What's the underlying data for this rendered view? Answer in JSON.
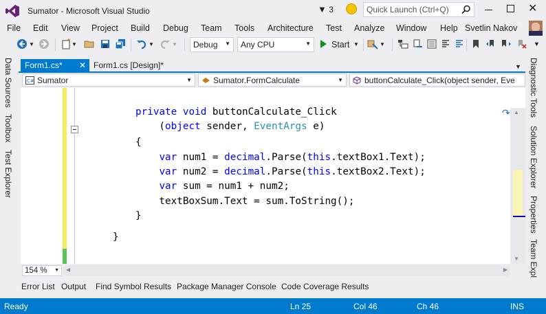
{
  "window": {
    "title": "Sumator - Microsoft Visual Studio",
    "notifications_count": "3",
    "quick_launch_placeholder": "Quick Launch (Ctrl+Q)"
  },
  "menu": {
    "items": [
      "File",
      "Edit",
      "View",
      "Project",
      "Build",
      "Debug",
      "Team",
      "Tools",
      "Architecture",
      "Test",
      "Analyze",
      "Window",
      "Help"
    ],
    "user": "Svetlin Nakov"
  },
  "toolbar": {
    "configuration": "Debug",
    "platform": "Any CPU",
    "start_label": "Start"
  },
  "left_panel": {
    "tabs": [
      "Data Sources",
      "Toolbox",
      "Test Explorer"
    ]
  },
  "right_panel": {
    "tabs": [
      "Diagnostic Tools",
      "Solution Explorer",
      "Properties",
      "Team Expl"
    ]
  },
  "doc_tabs": [
    {
      "label": "Form1.cs*",
      "active": true
    },
    {
      "label": "Form1.cs [Design]*",
      "active": false
    }
  ],
  "navigation": {
    "project": "Sumator",
    "type": "Sumator.FormCalculate",
    "member": "buttonCalculate_Click(object sender, Even"
  },
  "code": {
    "lines": [
      [
        {
          "t": "private",
          "c": "kw"
        },
        {
          "t": " ",
          "c": "tx"
        },
        {
          "t": "void",
          "c": "kw"
        },
        {
          "t": " buttonCalculate_Click",
          "c": "tx"
        }
      ],
      [
        {
          "t": "    (",
          "c": "tx"
        },
        {
          "t": "object",
          "c": "kw"
        },
        {
          "t": " sender, ",
          "c": "tx"
        },
        {
          "t": "EventArgs",
          "c": "ty"
        },
        {
          "t": " e)",
          "c": "tx"
        }
      ],
      [
        {
          "t": "{",
          "c": "tx"
        }
      ],
      [
        {
          "t": "    ",
          "c": "tx"
        },
        {
          "t": "var",
          "c": "kw"
        },
        {
          "t": " num1 = ",
          "c": "tx"
        },
        {
          "t": "decimal",
          "c": "kw"
        },
        {
          "t": ".Parse(",
          "c": "tx"
        },
        {
          "t": "this",
          "c": "kw"
        },
        {
          "t": ".textBox1.Text);",
          "c": "tx"
        }
      ],
      [
        {
          "t": "    ",
          "c": "tx"
        },
        {
          "t": "var",
          "c": "kw"
        },
        {
          "t": " num2 = ",
          "c": "tx"
        },
        {
          "t": "decimal",
          "c": "kw"
        },
        {
          "t": ".Parse(",
          "c": "tx"
        },
        {
          "t": "this",
          "c": "kw"
        },
        {
          "t": ".textBox2.Text);",
          "c": "tx"
        }
      ],
      [
        {
          "t": "    ",
          "c": "tx"
        },
        {
          "t": "var",
          "c": "kw"
        },
        {
          "t": " sum = num1 + num2;",
          "c": "tx"
        }
      ],
      [
        {
          "t": "    textBoxSum.Text = sum.ToString();",
          "c": "tx"
        }
      ],
      [
        {
          "t": "}",
          "c": "tx"
        }
      ],
      [
        {
          "t": "}",
          "c": "tx"
        }
      ]
    ]
  },
  "editor": {
    "zoom": "154 %"
  },
  "bottom_tabs": [
    "Error List",
    "Output",
    "Find Symbol Results",
    "Package Manager Console",
    "Code Coverage Results"
  ],
  "status": {
    "state": "Ready",
    "line": "Ln 25",
    "col": "Col 46",
    "ch": "Ch 46",
    "mode": "INS"
  },
  "colors": {
    "accent": "#007ACC",
    "keyword": "#0000FF",
    "type": "#2B91AF",
    "changed_margin": "#F5EE5F",
    "saved_margin": "#57C45A"
  }
}
